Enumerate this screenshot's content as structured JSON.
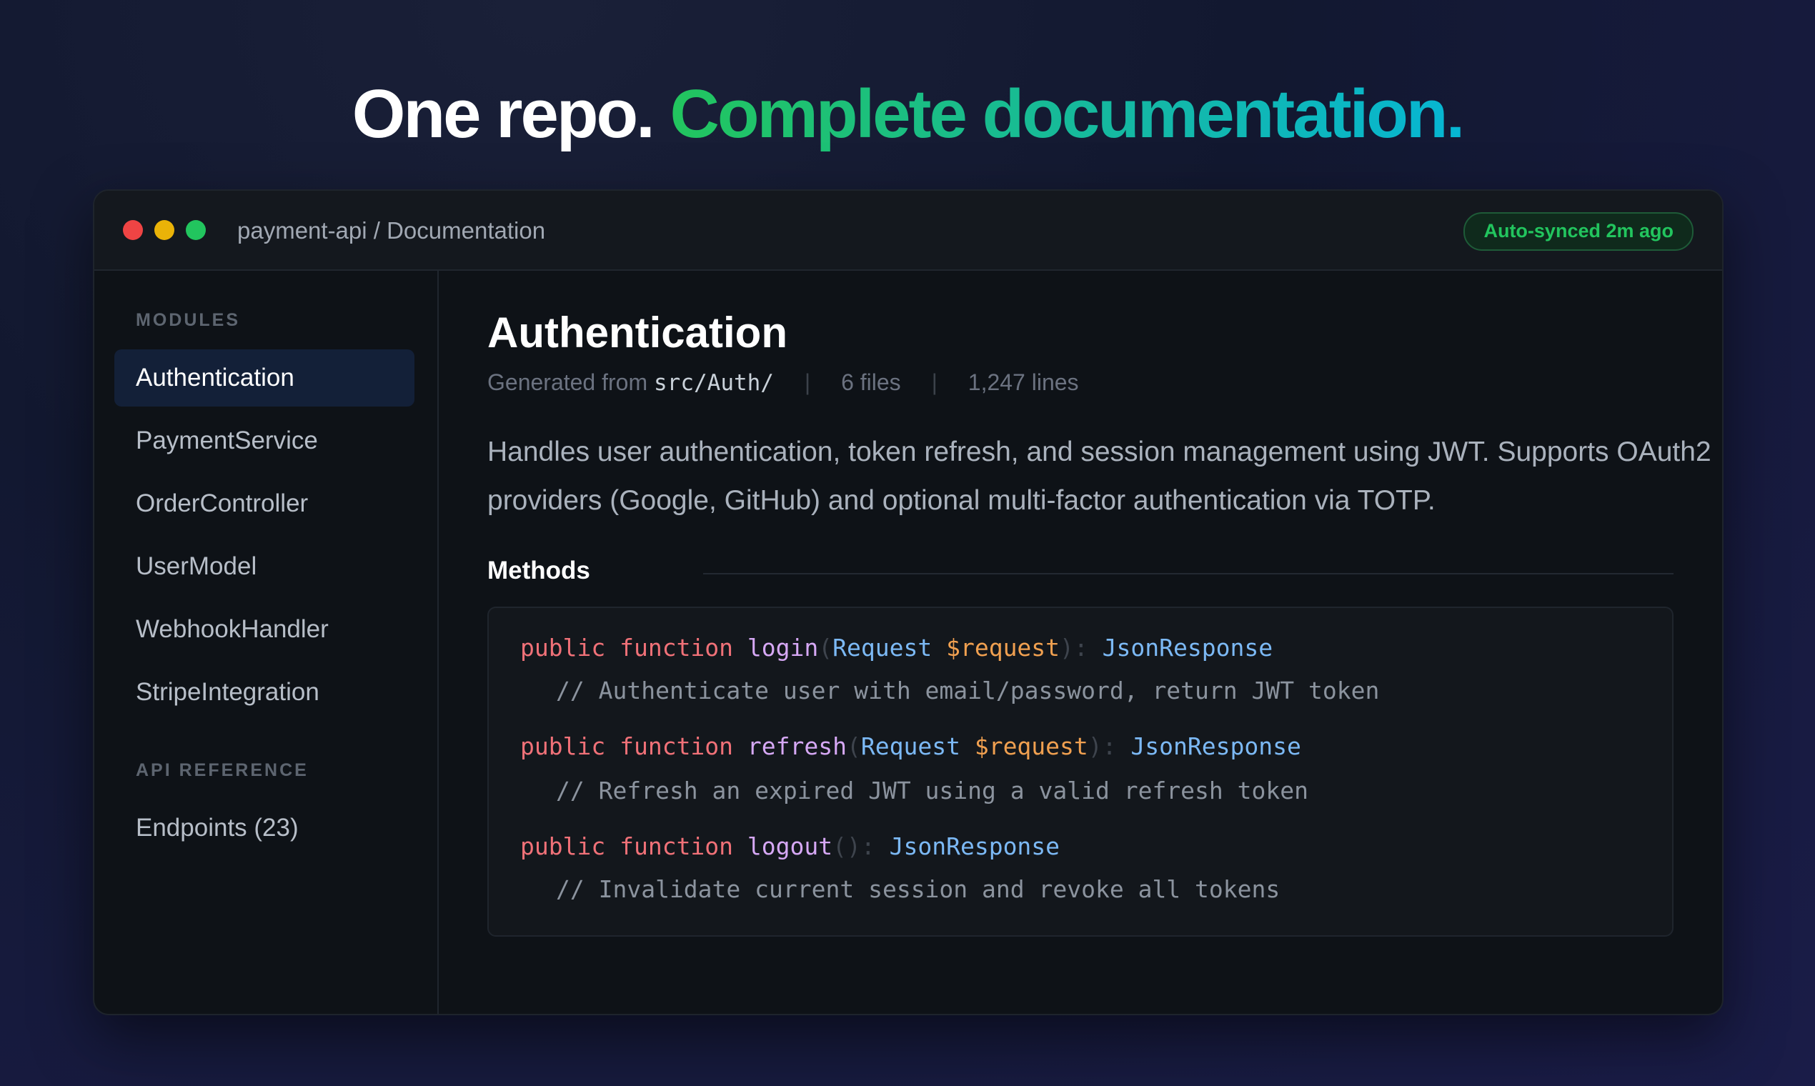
{
  "headline": {
    "part1": "One repo.",
    "part2": "Complete documentation."
  },
  "window": {
    "breadcrumb": "payment-api / Documentation",
    "sync_badge": "Auto-synced 2m ago"
  },
  "sidebar": {
    "modules_label": "MODULES",
    "modules": [
      {
        "label": "Authentication",
        "active": true
      },
      {
        "label": "PaymentService"
      },
      {
        "label": "OrderController"
      },
      {
        "label": "UserModel"
      },
      {
        "label": "WebhookHandler"
      },
      {
        "label": "StripeIntegration"
      }
    ],
    "api_label": "API REFERENCE",
    "api_items": [
      {
        "label": "Endpoints (23)"
      }
    ]
  },
  "main": {
    "title": "Authentication",
    "meta": {
      "generated_prefix": "Generated from",
      "path": "src/Auth/",
      "files": "6 files",
      "lines": "1,247 lines",
      "separator": "|"
    },
    "description": "Handles user authentication, token refresh, and session management using JWT. Supports OAuth2 providers (Google, GitHub) and optional multi-factor authentication via TOTP.",
    "methods_heading": "Methods",
    "methods": [
      {
        "modifier": "public",
        "keyword": "function",
        "name": "login",
        "open": "(",
        "param_type": "Request",
        "param_name": "$request",
        "close": "):",
        "return_type": "JsonResponse",
        "comment": "// Authenticate user with email/password, return JWT token"
      },
      {
        "modifier": "public",
        "keyword": "function",
        "name": "refresh",
        "open": "(",
        "param_type": "Request",
        "param_name": "$request",
        "close": "):",
        "return_type": "JsonResponse",
        "comment": "// Refresh an expired JWT using a valid refresh token"
      },
      {
        "modifier": "public",
        "keyword": "function",
        "name": "logout",
        "parens": "():",
        "return_type": "JsonResponse",
        "comment": "// Invalidate current session and revoke all tokens"
      }
    ]
  },
  "colors": {
    "accent_green": "#22c55e",
    "accent_teal": "#06b6d4",
    "keyword": "#f07178",
    "function_name": "#d6a8f5",
    "type": "#7cb9f5",
    "variable": "#f0a050"
  }
}
